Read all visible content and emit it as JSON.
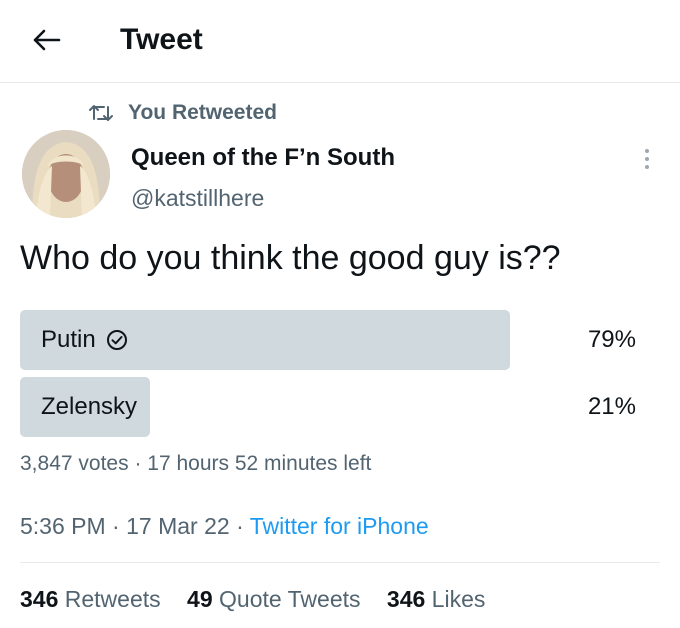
{
  "header": {
    "title": "Tweet"
  },
  "retweet": {
    "label": "You Retweeted"
  },
  "author": {
    "name": "Queen of the F’n South",
    "handle": "@katstillhere"
  },
  "tweet": {
    "text": "Who do you think the good guy is??"
  },
  "poll": {
    "options": [
      {
        "label": "Putin",
        "percent_label": "79%",
        "percent": 79,
        "winner": true
      },
      {
        "label": "Zelensky",
        "percent_label": "21%",
        "percent": 21,
        "winner": false
      }
    ],
    "votes": "3,847 votes",
    "time_left": "17 hours 52 minutes left"
  },
  "meta": {
    "time": "5:36 PM",
    "date": "17 Mar 22",
    "source": "Twitter for iPhone"
  },
  "stats": {
    "retweets_count": "346",
    "retweets_label": "Retweets",
    "quotes_count": "49",
    "quotes_label": "Quote Tweets",
    "likes_count": "346",
    "likes_label": "Likes"
  },
  "colors": {
    "accent": "#1d9bf0",
    "poll_bar": "#cfd9de",
    "secondary_text": "#536471"
  }
}
